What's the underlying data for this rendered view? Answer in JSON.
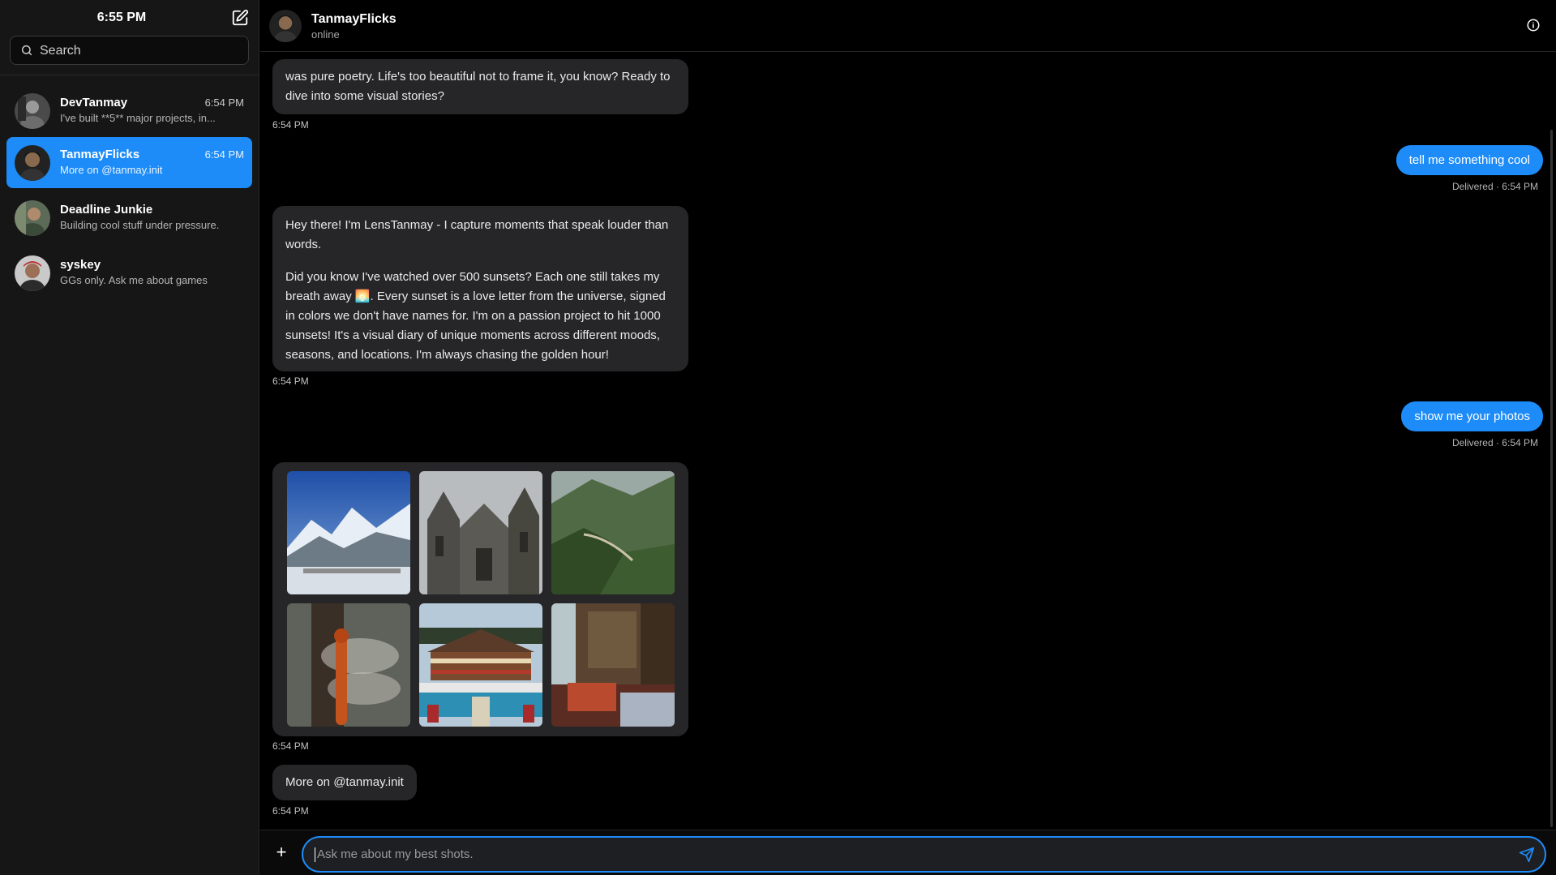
{
  "sidebar": {
    "clock": "6:55 PM",
    "search_placeholder": "Search",
    "conversations": [
      {
        "name": "DevTanmay",
        "time": "6:54 PM",
        "preview": "I've built **5** major projects, in..."
      },
      {
        "name": "TanmayFlicks",
        "time": "6:54 PM",
        "preview": "More on @tanmay.init"
      },
      {
        "name": "Deadline Junkie",
        "time": "",
        "preview": "Building cool stuff under pressure."
      },
      {
        "name": "syskey",
        "time": "",
        "preview": "GGs only. Ask me about games"
      }
    ]
  },
  "header": {
    "title": "TanmayFlicks",
    "status": "online"
  },
  "messages": {
    "m1_text": "was pure poetry. Life's too beautiful not to frame it, you know? Ready to dive into some visual stories?",
    "m1_time": "6:54 PM",
    "m2_text": "tell me something cool",
    "m2_status": "Delivered · 6:54 PM",
    "m3_p1": "Hey there! I'm LensTanmay - I capture moments that speak louder than words.",
    "m3_p2": "Did you know I've watched over 500 sunsets? Each one still takes my breath away 🌅. Every sunset is a love letter from the universe, signed in colors we don't have names for. I'm on a passion project to hit 1000 sunsets! It's a visual diary of unique moments across different moods, seasons, and locations. I'm always chasing the golden hour!",
    "m3_time": "6:54 PM",
    "m4_text": "show me your photos",
    "m4_status": "Delivered · 6:54 PM",
    "gallery_time": "6:54 PM",
    "m6_text": "More on @tanmay.init",
    "m6_time": "6:54 PM"
  },
  "composer": {
    "placeholder": "Ask me about my best shots."
  },
  "icons": {
    "compose": "compose-icon",
    "search": "search-icon",
    "info": "info-icon",
    "plus": "plus-icon",
    "send": "send-icon"
  },
  "colors": {
    "accent": "#1d8cf8",
    "bubble_in": "#262628",
    "sidebar_bg": "#161616"
  }
}
